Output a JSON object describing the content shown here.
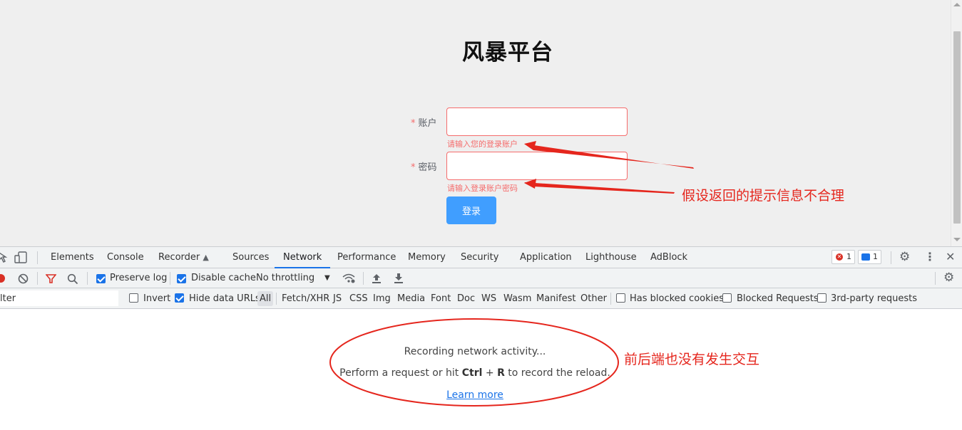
{
  "page": {
    "title": "风暴平台",
    "form": {
      "account": {
        "label": "账户",
        "required_mark": "*",
        "value": "",
        "error": "请输入您的登录账户"
      },
      "password": {
        "label": "密码",
        "required_mark": "*",
        "value": "",
        "error": "请输入登录账户密码"
      },
      "submit_label": "登录"
    }
  },
  "devtools": {
    "tabs": [
      {
        "label": "Elements"
      },
      {
        "label": "Console"
      },
      {
        "label": "Recorder"
      },
      {
        "label": "Sources"
      },
      {
        "label": "Network"
      },
      {
        "label": "Performance"
      },
      {
        "label": "Memory"
      },
      {
        "label": "Security"
      },
      {
        "label": "Application"
      },
      {
        "label": "Lighthouse"
      },
      {
        "label": "AdBlock"
      }
    ],
    "active_tab": "Network",
    "error_count": "1",
    "message_count": "1",
    "toolbar": {
      "preserve_log": {
        "label": "Preserve log",
        "checked": true
      },
      "disable_cache": {
        "label": "Disable cache",
        "checked": true
      },
      "throttling": "No throttling"
    },
    "filter": {
      "placeholder": "Filter",
      "visible_text": "lter",
      "invert": {
        "label": "Invert",
        "checked": false
      },
      "hide_data_urls": {
        "label": "Hide data URLs",
        "checked": true
      },
      "types": [
        "All",
        "Fetch/XHR",
        "JS",
        "CSS",
        "Img",
        "Media",
        "Font",
        "Doc",
        "WS",
        "Wasm",
        "Manifest",
        "Other"
      ],
      "selected_type": "All",
      "has_blocked_cookies": {
        "label": "Has blocked cookies",
        "checked": false
      },
      "blocked_requests": {
        "label": "Blocked Requests",
        "checked": false
      },
      "third_party": {
        "label": "3rd-party requests",
        "checked": false
      }
    },
    "empty_state": {
      "recording": "Recording network activity...",
      "hint_prefix": "Perform a request or hit ",
      "hint_key1": "Ctrl",
      "hint_plus": " + ",
      "hint_key2": "R",
      "hint_suffix": " to record the reload.",
      "learn_more": "Learn more"
    }
  },
  "annotations": {
    "note1": "假设返回的提示信息不合理",
    "note2": "前后端也没有发生交互",
    "color": "#e5261d"
  },
  "colors": {
    "danger": "#f56c6c",
    "primary_button": "#409eff",
    "devtools_accent": "#1a73e8"
  }
}
